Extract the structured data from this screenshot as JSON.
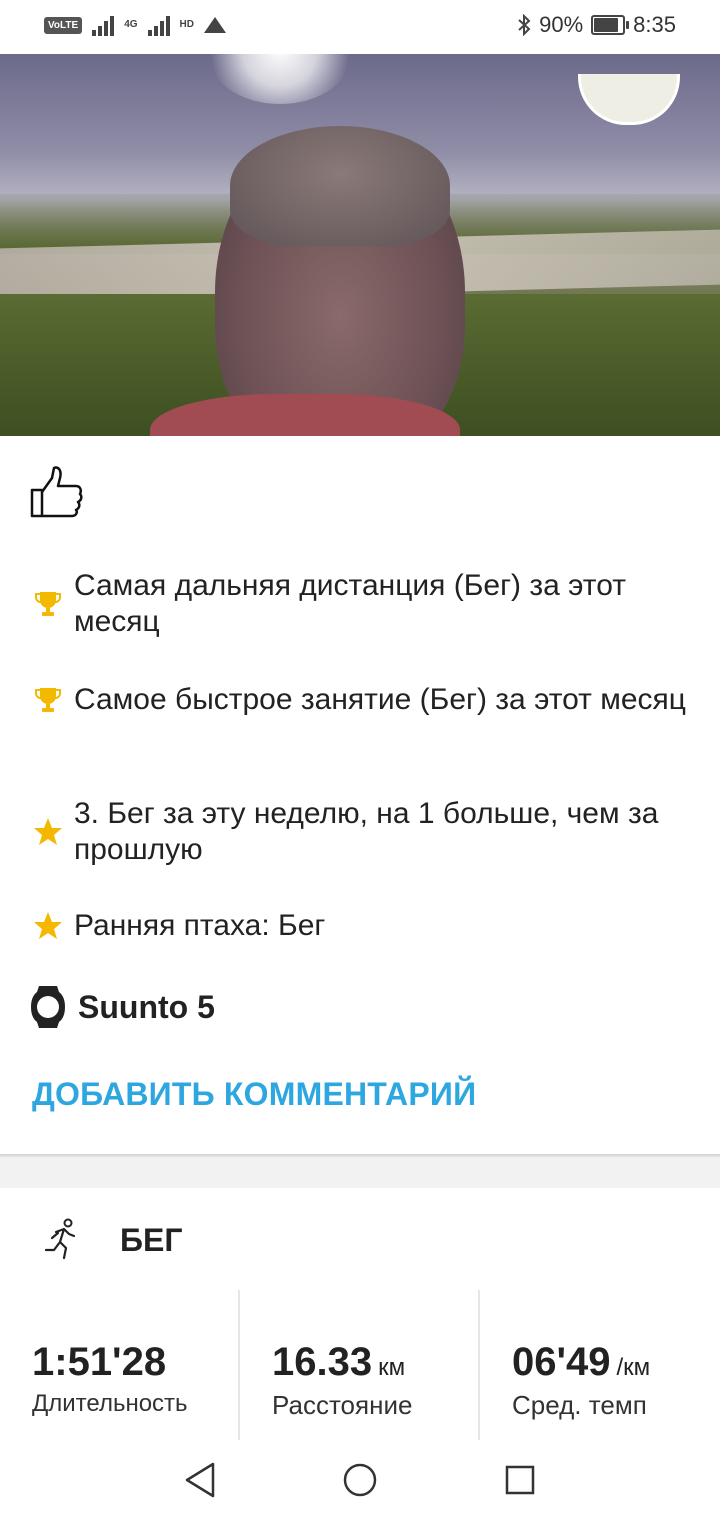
{
  "status_bar": {
    "volte": "VoLTE",
    "network_top": "4G",
    "network_bottom": "HD",
    "battery_percent": "90%",
    "battery_level": 0.9,
    "time": "8:35",
    "icons": [
      "signal-icon",
      "bluetooth-icon",
      "battery-icon"
    ]
  },
  "post": {
    "like_icon": "thumbs-up-icon",
    "achievements": [
      {
        "icon": "trophy-icon",
        "text": "Самая дальняя дистанция (Бег) за этот месяц"
      },
      {
        "icon": "trophy-icon",
        "text": "Самое быстрое занятие (Бег) за этот месяц"
      },
      {
        "icon": "star-icon",
        "text": "3. Бег за эту неделю, на 1 больше, чем за прошлую"
      },
      {
        "icon": "star-icon",
        "text": "Ранняя птаха: Бег"
      }
    ],
    "device_icon": "watch-icon",
    "device": "Suunto 5",
    "add_comment": "ДОБАВИТЬ КОММЕНТАРИЙ"
  },
  "activity": {
    "sport_icon": "running-icon",
    "sport": "БЕГ",
    "stats": [
      {
        "value": "1:51'28",
        "unit": "",
        "label": "Длительность"
      },
      {
        "value": "16.33",
        "unit": "км",
        "label": "Расстояние"
      },
      {
        "value": "06'49",
        "unit": "/км",
        "label": "Сред. темп"
      }
    ]
  },
  "nav": {
    "icons": [
      "back-icon",
      "home-icon",
      "recents-icon"
    ]
  },
  "colors": {
    "accent": "#2ea7e0",
    "trophy": "#f5b800",
    "star": "#f5b800"
  }
}
